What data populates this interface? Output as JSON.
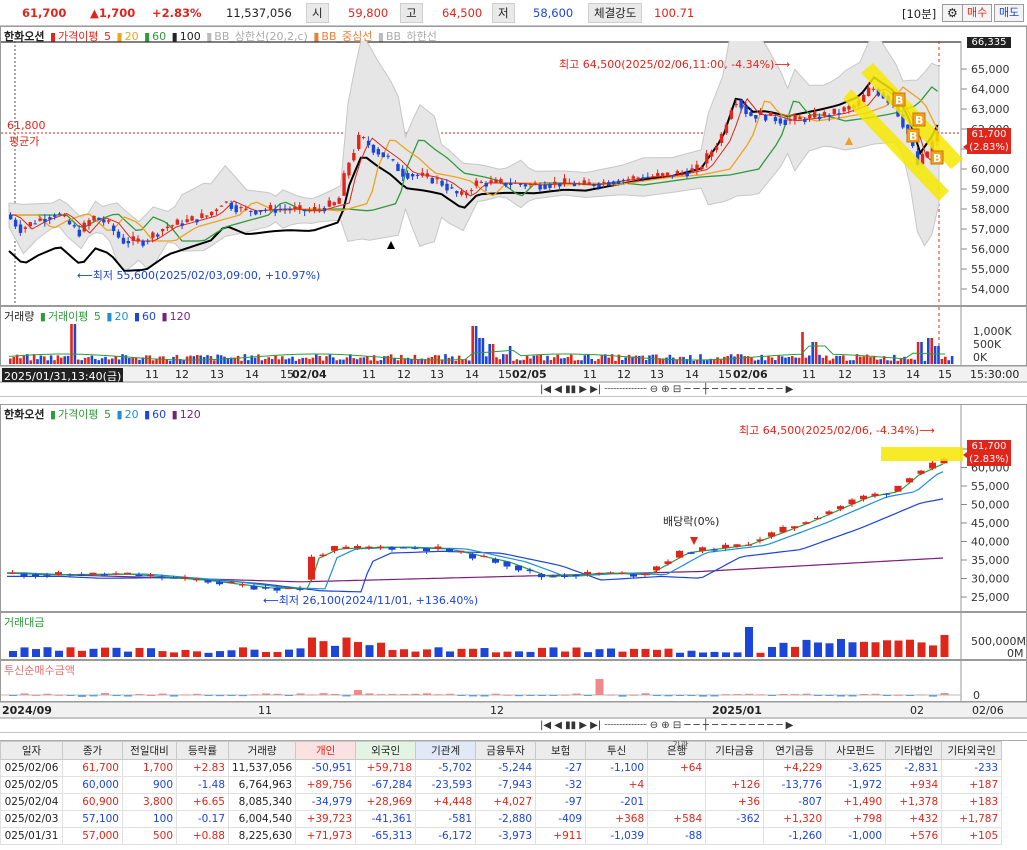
{
  "quote": {
    "price": "61,700",
    "change": "▲1,700",
    "rate": "+2.83%",
    "volume": "11,537,056",
    "open_label": "시",
    "open": "59,800",
    "high_label": "고",
    "high": "64,500",
    "low_label": "저",
    "low": "58,600",
    "strength_label": "체결강도",
    "strength": "100.71",
    "interval": "[10분]",
    "buy": "매수",
    "sell": "매도"
  },
  "colors": {
    "up": "#e0261b",
    "down": "#1c45d9",
    "ma5": "#e0261b",
    "ma20": "#f0a21e",
    "ma60": "#2f9b3a",
    "ma100": "#000000",
    "bb": "#c7c7c7"
  },
  "top_chart": {
    "legend": {
      "name": "한화오션",
      "ma_label": "가격이평",
      "ma5": "5",
      "ma20": "20",
      "ma60": "60",
      "ma100": "100",
      "bb_upper": "BB_상한선(20,2,c)",
      "bb_mid": "BB_중심선",
      "bb_lower": "BB_하한선"
    },
    "y_ticks": [
      "65,000",
      "64,000",
      "63,000",
      "62,000",
      "61,000",
      "60,000",
      "59,000",
      "58,000",
      "57,000",
      "56,000",
      "55,000",
      "54,000"
    ],
    "y_top": "66,335",
    "cur_price": "61,700",
    "cur_rate": "(2.83%)",
    "avg_label": "61,800",
    "avg_text": "평균가",
    "high_annotation": "최고 64,500(2025/02/06,11:00, -4.34%)⟶",
    "low_annotation": "⟵최저 55,600(2025/02/03,09:00, +10.97%)",
    "markers": [
      "B",
      "B",
      "B",
      "B"
    ]
  },
  "top_volume": {
    "legend": {
      "name": "거래량",
      "ma_label": "거래이평",
      "v5": "5",
      "v20": "20",
      "v60": "60",
      "v120": "120"
    },
    "y_ticks": [
      "1,000K",
      "500K",
      "0K"
    ]
  },
  "top_axis": {
    "date_box": "2025/01/31,13:40(금)",
    "labels": [
      "11",
      "12",
      "13",
      "14",
      "15",
      "02/04",
      "11",
      "12",
      "13",
      "14",
      "15",
      "02/05",
      "11",
      "12",
      "13",
      "14",
      "15",
      "02/06",
      "11",
      "12",
      "13",
      "14",
      "15"
    ],
    "end": "15:30:00"
  },
  "bottom_chart": {
    "legend": {
      "name": "한화오션",
      "ma_label": "가격이평",
      "ma5": "5",
      "ma20": "20",
      "ma60": "60",
      "ma120": "120"
    },
    "y_ticks": [
      "65,000",
      "60,000",
      "55,000",
      "50,000",
      "45,000",
      "40,000",
      "35,000",
      "30,000",
      "25,000"
    ],
    "cur_price": "61,700",
    "cur_rate": "(2.83%)",
    "high_annotation": "최고 64,500(2025/02/06, -4.34%)⟶",
    "low_annotation": "⟵최저 26,100(2024/11/01, +136.40%)",
    "dividend": "배당락(0%)"
  },
  "amount_panel": {
    "title": "거래대금",
    "y_ticks": [
      "500,000M",
      "0M"
    ]
  },
  "fund_panel": {
    "title": "투신순매수금액",
    "y_ticks": [
      "0"
    ]
  },
  "bottom_axis": {
    "labels": [
      "2024/09",
      "11",
      "12",
      "2025/01",
      "02"
    ],
    "end": "02/06"
  },
  "table": {
    "headers": [
      "일자",
      "종가",
      "전일대비",
      "등락률",
      "거래량",
      "개인",
      "외국인",
      "기관계",
      "금융투자",
      "보험",
      "투신",
      "은행",
      "기타금융",
      "연기금등",
      "사모펀드",
      "기타법인",
      "기타외국인"
    ],
    "group_label": "기관",
    "rows": [
      [
        "025/02/06",
        "61,700",
        "1,700",
        "+2.83",
        "11,537,056",
        "-50,951",
        "+59,718",
        "-5,702",
        "-5,244",
        "-27",
        "-1,100",
        "+64",
        "",
        "+4,229",
        "-3,625",
        "-2,831",
        "-233"
      ],
      [
        "025/02/05",
        "60,000",
        "900",
        "-1.48",
        "6,764,963",
        "+89,756",
        "-67,284",
        "-23,593",
        "-7,943",
        "-32",
        "+4",
        "",
        "+126",
        "-13,776",
        "-1,972",
        "+934",
        "+187"
      ],
      [
        "025/02/04",
        "60,900",
        "3,800",
        "+6.65",
        "8,085,340",
        "-34,979",
        "+28,969",
        "+4,448",
        "+4,027",
        "-97",
        "-201",
        "",
        "+36",
        "-807",
        "+1,490",
        "+1,378",
        "+183"
      ],
      [
        "025/02/03",
        "57,100",
        "100",
        "-0.17",
        "6,004,540",
        "+39,723",
        "-41,361",
        "-581",
        "-2,880",
        "-409",
        "+368",
        "+584",
        "-362",
        "+1,320",
        "+798",
        "+432",
        "+1,787"
      ],
      [
        "025/01/31",
        "57,000",
        "500",
        "+0.88",
        "8,225,630",
        "+71,973",
        "-65,313",
        "-6,172",
        "-3,973",
        "+911",
        "-1,039",
        "-88",
        "",
        "-1,260",
        "-1,000",
        "+576",
        "+105"
      ]
    ]
  }
}
